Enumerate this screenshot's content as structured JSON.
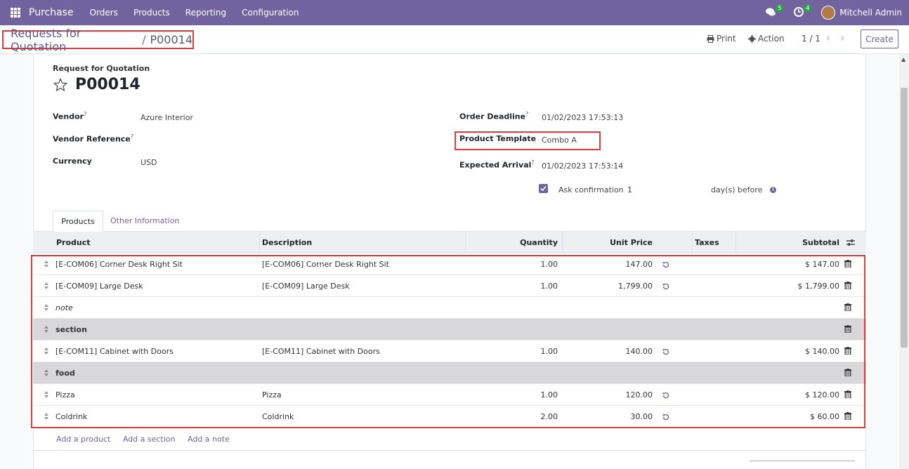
{
  "navbar": {
    "app_name": "Purchase",
    "menu": [
      "Orders",
      "Products",
      "Reporting",
      "Configuration"
    ],
    "messages_count": "5",
    "activities_count": "4",
    "user_name": "Mitchell Admin"
  },
  "control_panel": {
    "breadcrumb_parent": "Requests for Quotation",
    "breadcrumb_separator": "/",
    "breadcrumb_current": "P00014",
    "print_label": "Print",
    "action_label": "Action",
    "pager": "1 / 1",
    "create_label": "Create"
  },
  "form": {
    "doc_type": "Request for Quotation",
    "name": "P00014",
    "vendor_label": "Vendor",
    "vendor_value": "Azure Interior",
    "vendor_ref_label": "Vendor Reference",
    "vendor_ref_value": "",
    "currency_label": "Currency",
    "currency_value": "USD",
    "order_deadline_label": "Order Deadline",
    "order_deadline_value": "01/02/2023 17:53:13",
    "product_template_label": "Product Template",
    "product_template_value": "Combo A",
    "expected_arrival_label": "Expected Arrival",
    "expected_arrival_value": "01/02/2023 17:53:14",
    "ask_confirmation_label": "Ask confirmation",
    "ask_confirmation_days": "1",
    "days_before_label": "day(s) before",
    "help_mark": "?"
  },
  "tabs": {
    "products": "Products",
    "other_info": "Other Information"
  },
  "table": {
    "headers": {
      "product": "Product",
      "description": "Description",
      "quantity": "Quantity",
      "unit_price": "Unit Price",
      "taxes": "Taxes",
      "subtotal": "Subtotal"
    },
    "rows": [
      {
        "kind": "product",
        "product": "[E-COM06] Corner Desk Right Sit",
        "description": "[E-COM06] Corner Desk Right Sit",
        "quantity": "1.00",
        "unit_price": "147.00",
        "subtotal": "$ 147.00"
      },
      {
        "kind": "product",
        "product": "[E-COM09] Large Desk",
        "description": "[E-COM09] Large Desk",
        "quantity": "1.00",
        "unit_price": "1,799.00",
        "subtotal": "$ 1,799.00"
      },
      {
        "kind": "note",
        "product": "note"
      },
      {
        "kind": "section",
        "product": "section"
      },
      {
        "kind": "product",
        "product": "[E-COM11] Cabinet with Doors",
        "description": "[E-COM11] Cabinet with Doors",
        "quantity": "1.00",
        "unit_price": "140.00",
        "subtotal": "$ 140.00"
      },
      {
        "kind": "section",
        "product": "food"
      },
      {
        "kind": "product",
        "product": "Pizza",
        "description": "Pizza",
        "quantity": "1.00",
        "unit_price": "120.00",
        "subtotal": "$ 120.00"
      },
      {
        "kind": "product",
        "product": "Coldrink",
        "description": "Coldrink",
        "quantity": "2.00",
        "unit_price": "30.00",
        "subtotal": "$ 60.00"
      }
    ],
    "add_product": "Add a product",
    "add_section": "Add a section",
    "add_note": "Add a note"
  },
  "colors": {
    "brand": "#71639e",
    "highlight": "#e03c3c"
  }
}
